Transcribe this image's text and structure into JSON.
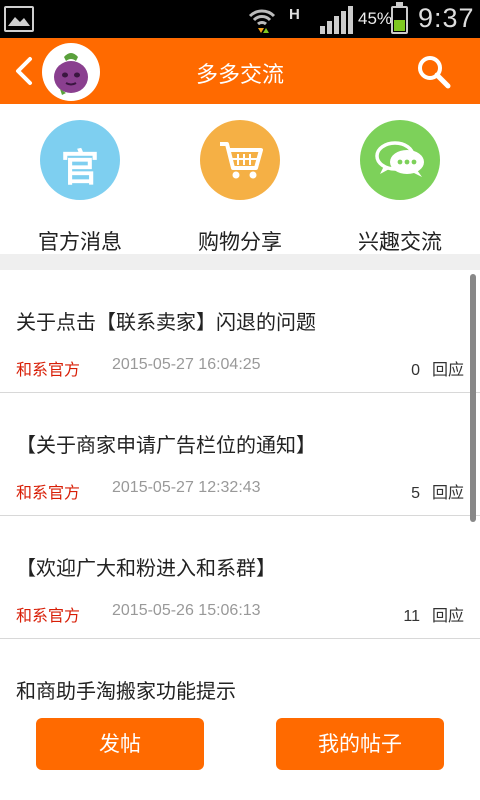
{
  "status_bar": {
    "network": "H",
    "battery": "45%",
    "battery_level": 0.45,
    "time": "9:37"
  },
  "header": {
    "title": "多多交流",
    "back_icon": "chevron-left-icon",
    "search_icon": "search-icon",
    "avatar_icon": "eggplant-mascot-icon"
  },
  "categories": [
    {
      "label": "官方消息",
      "glyph": "官",
      "color": "#7ecff0",
      "icon": "official-icon"
    },
    {
      "label": "购物分享",
      "color": "#f5b045",
      "icon": "shopping-cart-icon"
    },
    {
      "label": "兴趣交流",
      "color": "#7dd15a",
      "icon": "chat-bubbles-icon"
    }
  ],
  "posts": [
    {
      "title": "关于点击【联系卖家】闪退的问题",
      "author": "和系官方",
      "time": "2015-05-27 16:04:25",
      "count": "0",
      "reply_label": "回应"
    },
    {
      "title": "【关于商家申请广告栏位的通知】",
      "author": "和系官方",
      "time": "2015-05-27 12:32:43",
      "count": "5",
      "reply_label": "回应"
    },
    {
      "title": "【欢迎广大和粉进入和系群】",
      "author": "和系官方",
      "time": "2015-05-26 15:06:13",
      "count": "11",
      "reply_label": "回应"
    },
    {
      "title": "和商助手淘搬家功能提示"
    }
  ],
  "footer": {
    "post_button": "发帖",
    "my_posts_button": "我的帖子"
  },
  "colors": {
    "accent": "#ff6a00",
    "author_red": "#d81e06"
  }
}
